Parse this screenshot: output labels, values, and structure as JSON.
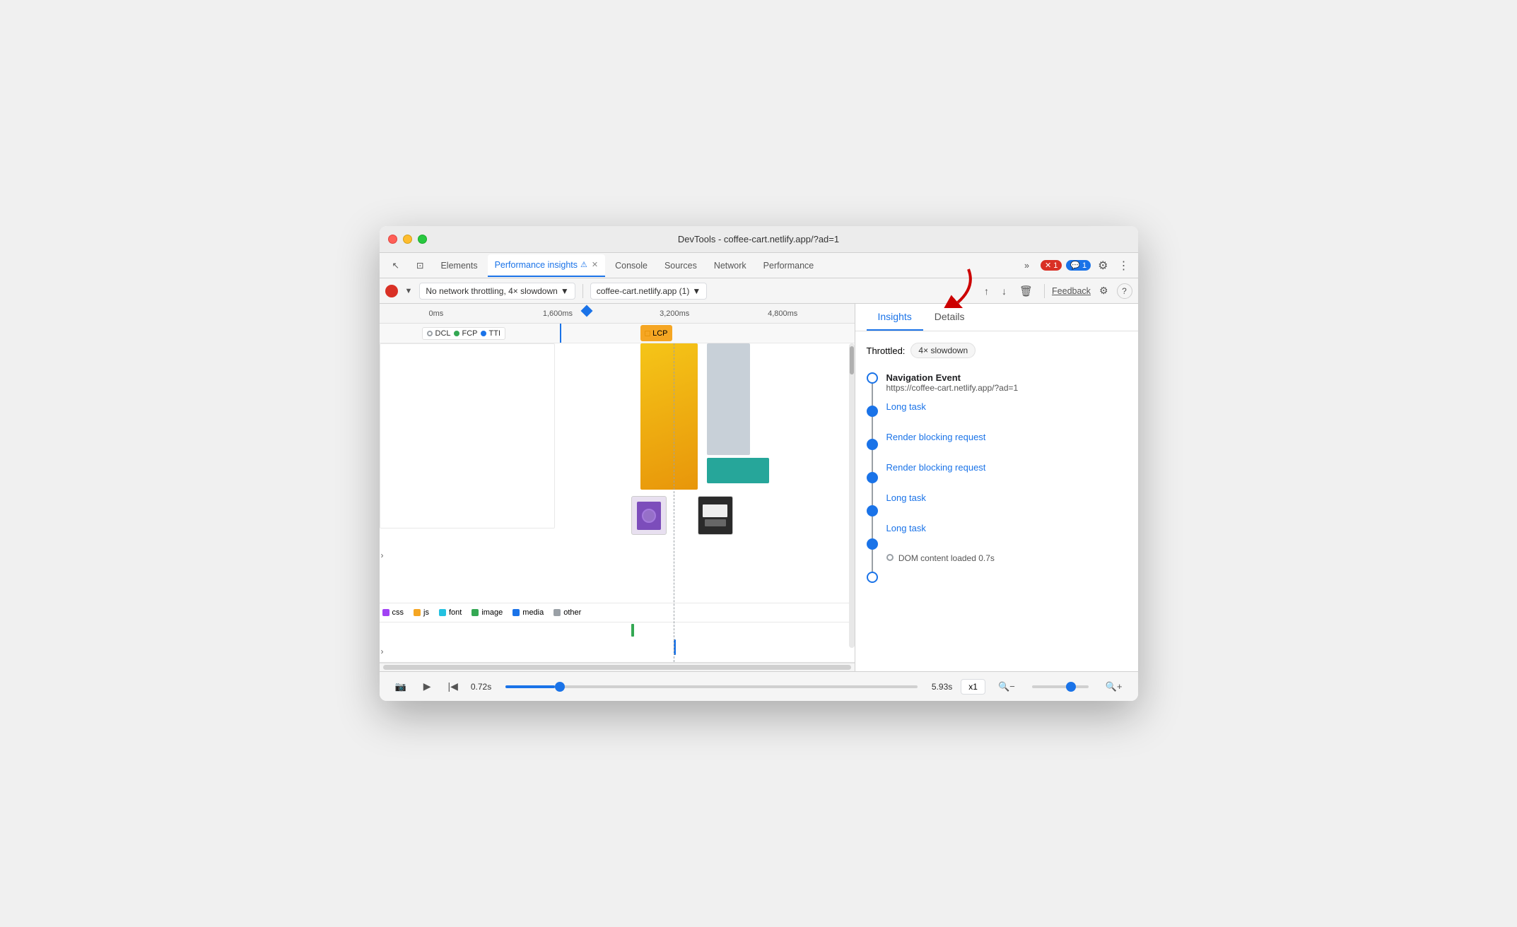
{
  "window": {
    "title": "DevTools - coffee-cart.netlify.app/?ad=1"
  },
  "tabs": [
    {
      "id": "cursor",
      "label": "↖",
      "active": false
    },
    {
      "id": "device",
      "label": "⊡",
      "active": false
    },
    {
      "id": "elements",
      "label": "Elements",
      "active": false
    },
    {
      "id": "performance-insights",
      "label": "Performance insights",
      "active": true
    },
    {
      "id": "console",
      "label": "Console",
      "active": false
    },
    {
      "id": "sources",
      "label": "Sources",
      "active": false
    },
    {
      "id": "network",
      "label": "Network",
      "active": false
    },
    {
      "id": "performance",
      "label": "Performance",
      "active": false
    }
  ],
  "tab_actions": {
    "more": "»",
    "errors": "1",
    "messages": "1",
    "settings": "⚙",
    "more_vert": "⋮"
  },
  "toolbar": {
    "record_label": "●",
    "throttle_label": "No network throttling, 4× slowdown",
    "url_label": "coffee-cart.netlify.app (1)",
    "upload_label": "↑",
    "download_label": "↓",
    "delete_label": "🗑",
    "feedback_label": "Feedback",
    "settings_label": "⚙",
    "help_label": "?"
  },
  "time_markers": [
    "0ms",
    "1,600ms",
    "3,200ms",
    "4,800ms"
  ],
  "milestones": [
    {
      "label": "DCL",
      "color": "#9aa0a6"
    },
    {
      "label": "FCP",
      "color": "#34a853"
    },
    {
      "label": "TTI",
      "color": "#1a73e8"
    },
    {
      "label": "LCP",
      "color": "#f5a623",
      "highlighted": true
    }
  ],
  "legend": [
    {
      "label": "css",
      "color": "#a142f4"
    },
    {
      "label": "js",
      "color": "#f5a623"
    },
    {
      "label": "font",
      "color": "#24c1e0"
    },
    {
      "label": "image",
      "color": "#34a853"
    },
    {
      "label": "media",
      "color": "#1a73e8"
    },
    {
      "label": "other",
      "color": "#9aa0a6"
    }
  ],
  "insights_panel": {
    "tabs": [
      "Insights",
      "Details"
    ],
    "active_tab": "Insights",
    "throttled_label": "Throttled:",
    "throttle_value": "4× slowdown",
    "events": [
      {
        "type": "nav",
        "title": "Navigation Event",
        "url": "https://coffee-cart.netlify.app/?ad=1"
      },
      {
        "type": "link",
        "label": "Long task"
      },
      {
        "type": "link",
        "label": "Render blocking request"
      },
      {
        "type": "link",
        "label": "Render blocking request"
      },
      {
        "type": "link",
        "label": "Long task"
      },
      {
        "type": "link",
        "label": "Long task"
      },
      {
        "type": "dom",
        "label": "DOM content loaded 0.7s"
      }
    ]
  },
  "bottom_bar": {
    "time_start": "0.72s",
    "time_end": "5.93s",
    "speed": "x1",
    "zoom_icon_left": "🔍",
    "zoom_icon_right": "🔍"
  }
}
